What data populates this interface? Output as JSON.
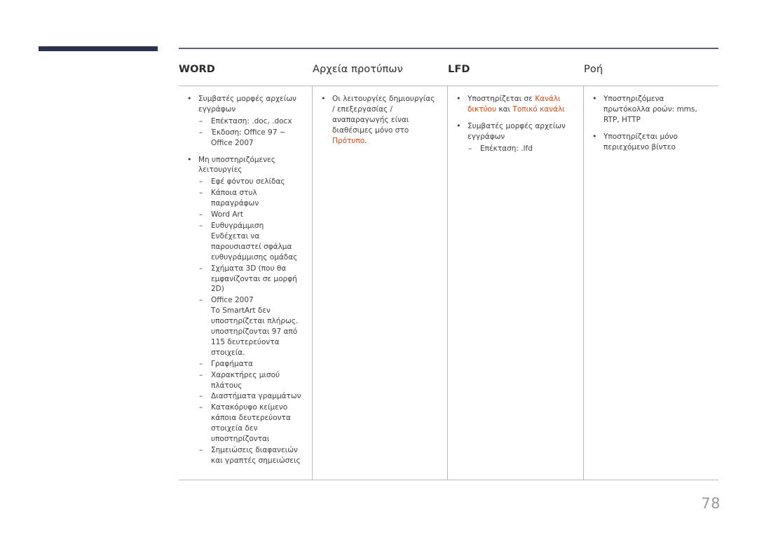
{
  "page": {
    "number": "78",
    "accent_color": "#e3430f",
    "rule_color": "#2b3350",
    "line_color": "#595f77"
  },
  "table": {
    "columns": [
      {
        "header": "WORD",
        "bold": true
      },
      {
        "header": "Αρχεία προτύπων",
        "bold": false
      },
      {
        "header": "LFD",
        "bold": true
      },
      {
        "header": "Ροή",
        "bold": false
      }
    ],
    "col1": {
      "b1": "Συμβατές μορφές αρχείων εγγράφων",
      "b1_s1": "Επέκταση: .doc, .docx",
      "b1_s2": "Έκδοση: Office 97 ~ Office 2007",
      "b2": "Μη υποστηριζόμενες λειτουργίες",
      "b2_s1": "Εφέ φόντου σελίδας",
      "b2_s2": "Κάποια στυλ παραγράφων",
      "b2_s3": "Word Art",
      "b2_s4": "Ευθυγράμμιση",
      "b2_s4_cont": "Ενδέχεται να παρουσιαστεί σφάλμα ευθυγράμμισης ομάδας",
      "b2_s5": "Σχήματα 3D (που θα εμφανίζονται σε μορφή 2D)",
      "b2_s6": "Office 2007",
      "b2_s6_cont": "Το SmartArt δεν υποστηρίζεται πλήρως. υποστηρίζονται 97 από 115 δευτερεύοντα στοιχεία.",
      "b2_s7": "Γραφήματα",
      "b2_s8": "Χαρακτήρες μισού πλάτους",
      "b2_s9": "Διαστήματα γραμμάτων",
      "b2_s10": "Κατακόρυφο κείμενο",
      "b2_s10_cont": "κάποια δευτερεύοντα στοιχεία δεν υποστηρίζονται",
      "b2_s11": "Σημειώσεις διαφανειών και γραπτές σημειώσεις"
    },
    "col2": {
      "b1_pre": "Οι λειτουργίες δημιουργίας / επεξεργασίας / αναπαραγωγής είναι διαθέσιμες μόνο στο ",
      "b1_accent": "Πρότυπο",
      "b1_post": "."
    },
    "col3": {
      "b1_pre": "Υποστηρίζεται σε ",
      "b1_accent1": "Κανάλι δικτύου",
      "b1_mid": " και ",
      "b1_accent2": "Τοπικό κανάλι",
      "b2": "Συμβατές μορφές αρχείων εγγράφων",
      "b2_s1": "Επέκταση: .lfd"
    },
    "col4": {
      "b1": "Υποστηριζόμενα πρωτόκολλα ροών: mms, RTP, HTTP",
      "b2": "Υποστηρίζεται μόνο περιεχόμενο βίντεο"
    }
  }
}
